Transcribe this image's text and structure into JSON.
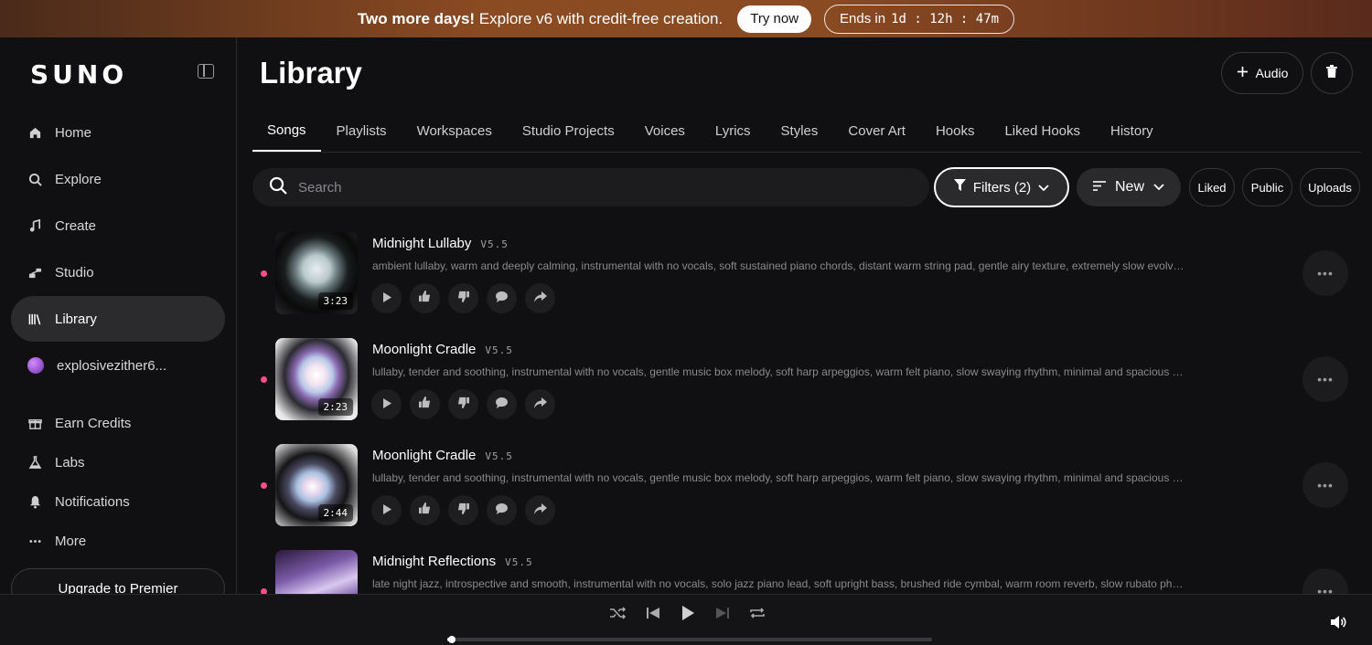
{
  "banner": {
    "bold": "Two more days!",
    "text": " Explore v6 with credit-free creation.",
    "try_label": "Try now",
    "ends_prefix": "Ends in",
    "ends_value": "1d : 12h : 47m"
  },
  "sidebar": {
    "logo": "SUNO",
    "items": [
      {
        "label": "Home",
        "icon": "home-icon"
      },
      {
        "label": "Explore",
        "icon": "search-icon"
      },
      {
        "label": "Create",
        "icon": "music-note-icon"
      },
      {
        "label": "Studio",
        "icon": "studio-icon"
      },
      {
        "label": "Library",
        "icon": "library-icon",
        "active": true
      },
      {
        "label": "explosivezither6...",
        "icon": "avatar"
      },
      {
        "label": "Earn Credits",
        "icon": "gift-icon"
      },
      {
        "label": "Labs",
        "icon": "flask-icon"
      },
      {
        "label": "Notifications",
        "icon": "bell-icon"
      },
      {
        "label": "More",
        "icon": "ellipsis-icon"
      }
    ],
    "upgrade_label": "Upgrade to Premier"
  },
  "main": {
    "title": "Library",
    "audio_label": "Audio",
    "tabs": [
      "Songs",
      "Playlists",
      "Workspaces",
      "Studio Projects",
      "Voices",
      "Lyrics",
      "Styles",
      "Cover Art",
      "Hooks",
      "Liked Hooks",
      "History"
    ],
    "active_tab": "Songs",
    "search_placeholder": "Search",
    "filters_label": "Filters (2)",
    "sort_label": "New",
    "chips": [
      "Liked",
      "Public",
      "Uploads"
    ]
  },
  "songs": [
    {
      "title": "Midnight Lullaby",
      "version": "V5.5",
      "duration": "3:23",
      "desc": "ambient lullaby, warm and deeply calming, instrumental with no vocals, soft sustained piano chords, distant warm string pad, gentle airy texture, extremely slow evolving..."
    },
    {
      "title": "Moonlight Cradle",
      "version": "V5.5",
      "duration": "2:23",
      "desc": "lullaby, tender and soothing, instrumental with no vocals, gentle music box melody, soft harp arpeggios, warm felt piano, slow swaying rhythm, minimal and spacious arr..."
    },
    {
      "title": "Moonlight Cradle",
      "version": "V5.5",
      "duration": "2:44",
      "desc": "lullaby, tender and soothing, instrumental with no vocals, gentle music box melody, soft harp arpeggios, warm felt piano, slow swaying rhythm, minimal and spacious arr..."
    },
    {
      "title": "Midnight Reflections",
      "version": "V5.5",
      "duration": "",
      "desc": "late night jazz, introspective and smooth, instrumental with no vocals, solo jazz piano lead, soft upright bass, brushed ride cymbal, warm room reverb, slow rubato phrasi..."
    }
  ],
  "player": {
    "progress": 0.01
  },
  "colors": {
    "accent_dot": "#ff4f8b",
    "background": "#101012"
  }
}
